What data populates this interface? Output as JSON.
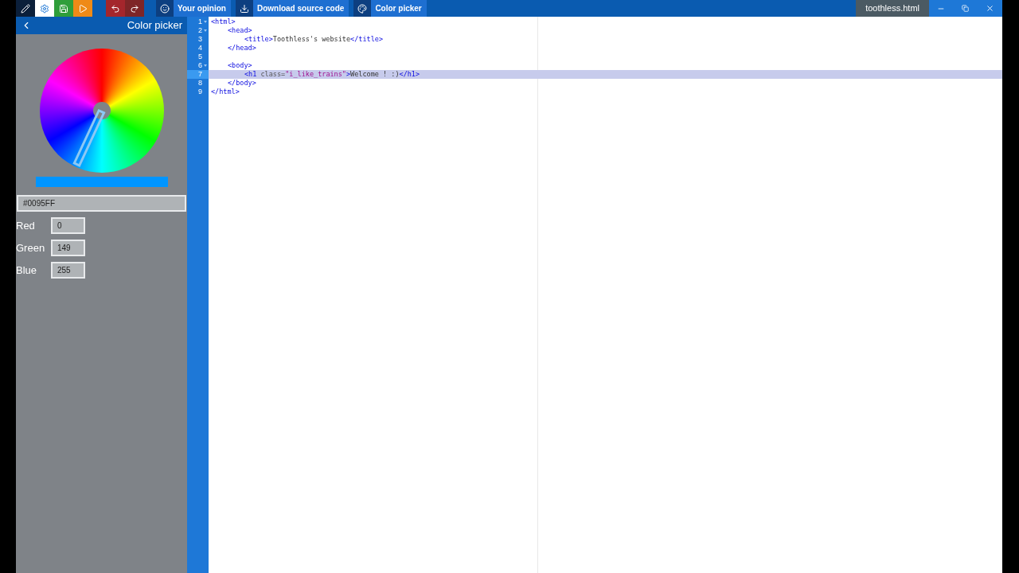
{
  "toolbar": {
    "actions": [
      {
        "kind": "logo"
      },
      {
        "kind": "settings"
      },
      {
        "kind": "save"
      },
      {
        "kind": "run"
      },
      {
        "kind": "undo"
      },
      {
        "kind": "redo"
      }
    ],
    "labeled": [
      {
        "kind": "opinion",
        "label": "Your opinion"
      },
      {
        "kind": "download",
        "label": "Download source code"
      },
      {
        "kind": "palette",
        "label": "Color picker"
      }
    ]
  },
  "window": {
    "title": "toothless.html"
  },
  "panel": {
    "title": "Color picker",
    "preview": {
      "color": "#0095ff"
    },
    "hex": "#0095FF",
    "channels": [
      {
        "name": "Red",
        "value": "0"
      },
      {
        "name": "Green",
        "value": "149"
      },
      {
        "name": "Blue",
        "value": "255"
      }
    ]
  },
  "editor": {
    "lines": [
      {
        "number": "1",
        "foldable": true,
        "selected": false,
        "tokens": [
          {
            "kind": "tag",
            "text": "<html>"
          }
        ],
        "children": [
          {
            "number": "2",
            "foldable": true,
            "selected": false,
            "tokens": [
              {
                "kind": "tag",
                "text": "<head>"
              }
            ],
            "children": [
              {
                "number": "3",
                "foldable": false,
                "selected": false,
                "tokens": [
                  {
                    "kind": "tag",
                    "text": "<title>"
                  },
                  {
                    "kind": "text",
                    "text": "Toothless's website"
                  },
                  {
                    "kind": "tag",
                    "text": "</title>"
                  }
                ]
              }
            ]
          },
          {
            "number": "4",
            "foldable": false,
            "selected": false,
            "tokens": [
              {
                "kind": "tag",
                "text": "</head>"
              }
            ]
          },
          {
            "number": "5",
            "foldable": false,
            "selected": false
          },
          {
            "number": "6",
            "foldable": true,
            "selected": false,
            "tokens": [
              {
                "kind": "tag",
                "text": "<body>"
              }
            ],
            "children": [
              {
                "number": "7",
                "foldable": false,
                "selected": true,
                "tokens": [
                  {
                    "kind": "tag",
                    "text": "<h1 "
                  },
                  {
                    "kind": "attr",
                    "text": "class="
                  },
                  {
                    "kind": "string",
                    "text": "\"i_like_trains\""
                  },
                  {
                    "kind": "tag",
                    "text": ">"
                  },
                  {
                    "kind": "text",
                    "text": "Welcome ! :)"
                  },
                  {
                    "kind": "tag",
                    "text": "</h1>"
                  }
                ]
              }
            ]
          },
          {
            "number": "8",
            "foldable": false,
            "selected": false,
            "tokens": [
              {
                "kind": "tag",
                "text": "</body>"
              }
            ]
          }
        ]
      },
      {
        "number": "9",
        "foldable": false,
        "selected": false,
        "tokens": [
          {
            "kind": "tag",
            "text": "</html>"
          }
        ]
      }
    ]
  }
}
